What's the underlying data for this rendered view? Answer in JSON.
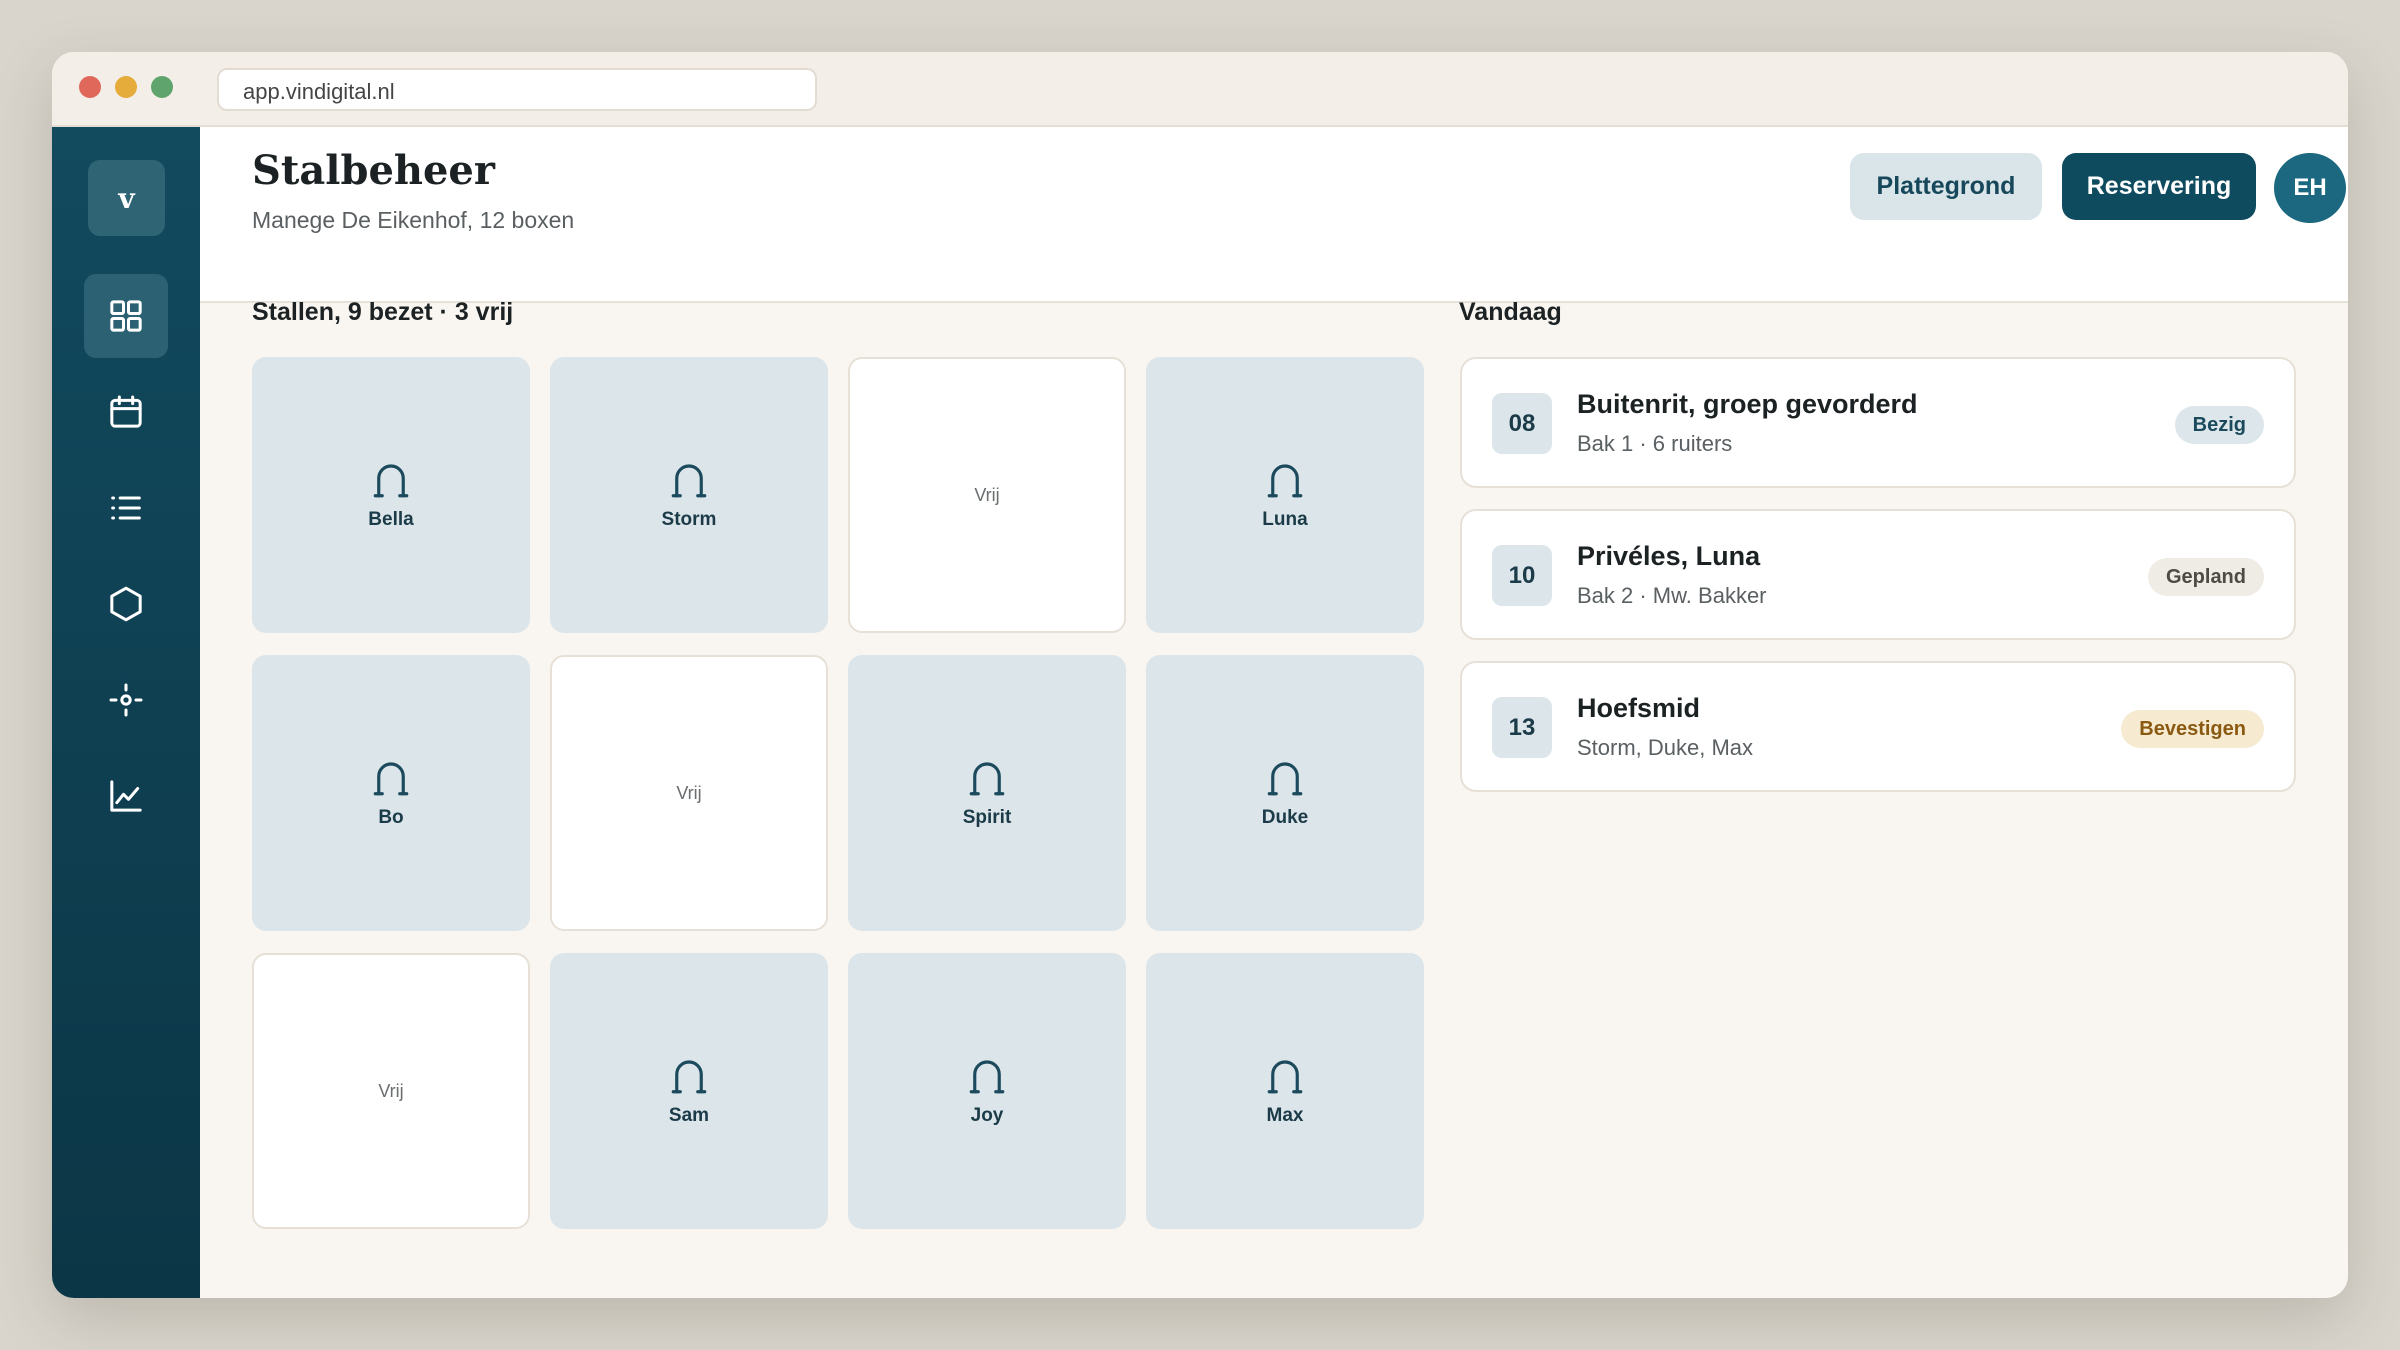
{
  "browser": {
    "url": "app.vindigital.nl"
  },
  "sidebar": {
    "logo_letter": "v",
    "items": [
      {
        "icon": "grid-icon",
        "active": true
      },
      {
        "icon": "calendar-icon",
        "active": false
      },
      {
        "icon": "list-icon",
        "active": false
      },
      {
        "icon": "hexagon-icon",
        "active": false
      },
      {
        "icon": "crosshair-icon",
        "active": false
      },
      {
        "icon": "chart-icon",
        "active": false
      }
    ]
  },
  "header": {
    "title": "Stalbeheer",
    "subtitle": "Manege De Eikenhof, 12 boxen",
    "floorplan_label": "Plattegrond",
    "reservation_label": "Reservering",
    "avatar_initials": "EH"
  },
  "stalls": {
    "heading": "Stallen, 9 bezet · 3 vrij",
    "free_label": "Vrij",
    "items": [
      {
        "name": "Bella",
        "occupied": true
      },
      {
        "name": "Storm",
        "occupied": true
      },
      {
        "name": "Vrij",
        "occupied": false
      },
      {
        "name": "Luna",
        "occupied": true
      },
      {
        "name": "Bo",
        "occupied": true
      },
      {
        "name": "Vrij",
        "occupied": false
      },
      {
        "name": "Spirit",
        "occupied": true
      },
      {
        "name": "Duke",
        "occupied": true
      },
      {
        "name": "Vrij",
        "occupied": false
      },
      {
        "name": "Sam",
        "occupied": true
      },
      {
        "name": "Joy",
        "occupied": true
      },
      {
        "name": "Max",
        "occupied": true
      }
    ]
  },
  "today": {
    "heading": "Vandaag",
    "events": [
      {
        "time": "08",
        "title": "Buitenrit, groep gevorderd",
        "detail": "Bak 1 · 6 ruiters",
        "status": "Bezig",
        "status_bg": "#dce6eb",
        "status_color": "#1b4a5c"
      },
      {
        "time": "10",
        "title": "Privéles, Luna",
        "detail": "Bak 2 · Mw. Bakker",
        "status": "Gepland",
        "status_bg": "#efece6",
        "status_color": "#4e4a44"
      },
      {
        "time": "13",
        "title": "Hoefsmid",
        "detail": "Storm, Duke, Max",
        "status": "Bevestigen",
        "status_bg": "#f6ead0",
        "status_color": "#8a5a12"
      }
    ]
  }
}
